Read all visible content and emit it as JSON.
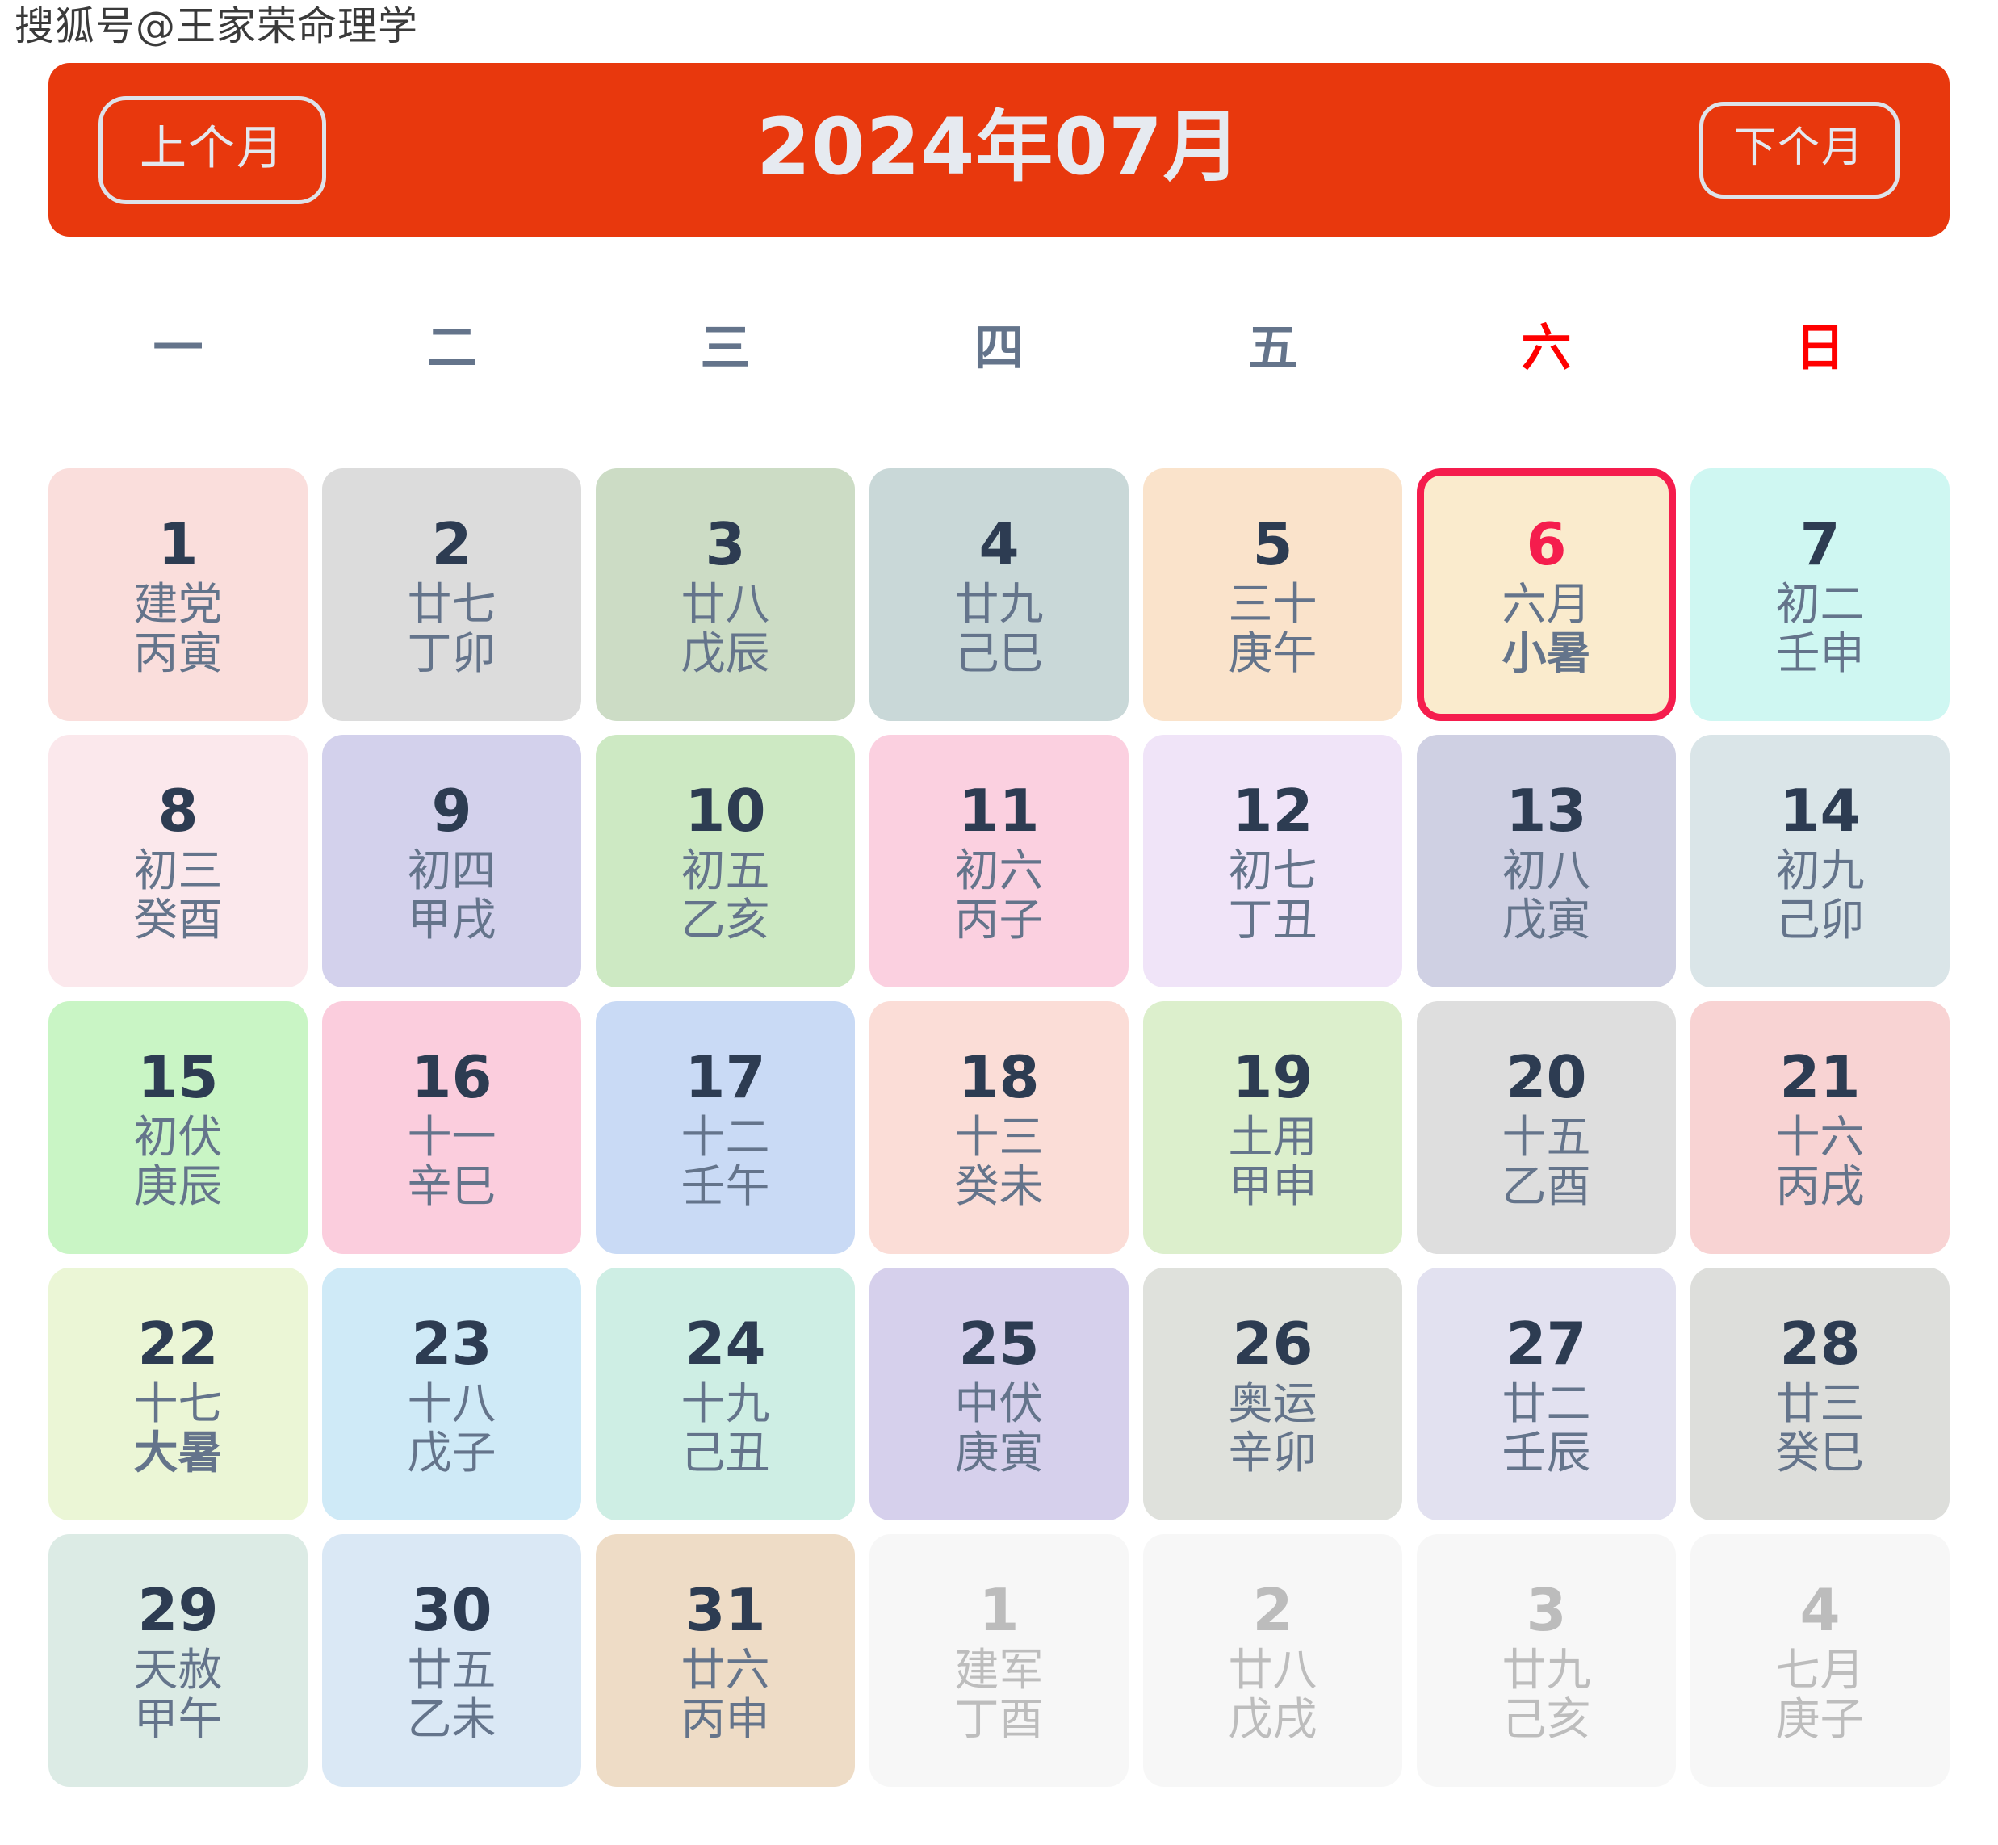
{
  "watermark": "搜狐号@王家荣命理学",
  "header": {
    "prev_label": "上个月",
    "title": "2024年07月",
    "next_label": "下个月",
    "bar_color": "#e8380d",
    "text_color": "#e6eaf0"
  },
  "weekdays": [
    {
      "label": "一",
      "weekend": false
    },
    {
      "label": "二",
      "weekend": false
    },
    {
      "label": "三",
      "weekend": false
    },
    {
      "label": "四",
      "weekend": false
    },
    {
      "label": "五",
      "weekend": false
    },
    {
      "label": "六",
      "weekend": true
    },
    {
      "label": "日",
      "weekend": true
    }
  ],
  "colors": {
    "weekday_normal": "#64748b",
    "weekend": "#ff0000",
    "daynum": "#2d3c52",
    "sublabel": "#64748b",
    "today_accent": "#f51d4d",
    "other_month_text": "#bdbdbd"
  },
  "cells": [
    {
      "day": "1",
      "l1": "建党",
      "l2": "丙寅",
      "bg": "#fadedc"
    },
    {
      "day": "2",
      "l1": "廿七",
      "l2": "丁卯",
      "bg": "#dcdcdc"
    },
    {
      "day": "3",
      "l1": "廿八",
      "l2": "戊辰",
      "bg": "#ccdcc5"
    },
    {
      "day": "4",
      "l1": "廿九",
      "l2": "己巳",
      "bg": "#c9d8d8"
    },
    {
      "day": "5",
      "l1": "三十",
      "l2": "庚午",
      "bg": "#fae3cb"
    },
    {
      "day": "6",
      "l1": "六月",
      "l2": "小暑",
      "bg": "#faebcd",
      "today": true
    },
    {
      "day": "7",
      "l1": "初二",
      "l2": "壬申",
      "bg": "#cff7f2"
    },
    {
      "day": "8",
      "l1": "初三",
      "l2": "癸酉",
      "bg": "#fbe8ec"
    },
    {
      "day": "9",
      "l1": "初四",
      "l2": "甲戌",
      "bg": "#d3d1ec"
    },
    {
      "day": "10",
      "l1": "初五",
      "l2": "乙亥",
      "bg": "#cde9c3"
    },
    {
      "day": "11",
      "l1": "初六",
      "l2": "丙子",
      "bg": "#fbd0e0"
    },
    {
      "day": "12",
      "l1": "初七",
      "l2": "丁丑",
      "bg": "#f0e4f8"
    },
    {
      "day": "13",
      "l1": "初八",
      "l2": "戊寅",
      "bg": "#cfd0e3"
    },
    {
      "day": "14",
      "l1": "初九",
      "l2": "己卯",
      "bg": "#dae5e8"
    },
    {
      "day": "15",
      "l1": "初伏",
      "l2": "庚辰",
      "bg": "#c9f5c5"
    },
    {
      "day": "16",
      "l1": "十一",
      "l2": "辛巳",
      "bg": "#fbcddd"
    },
    {
      "day": "17",
      "l1": "十二",
      "l2": "壬午",
      "bg": "#c9daf5"
    },
    {
      "day": "18",
      "l1": "十三",
      "l2": "癸未",
      "bg": "#fbddd7"
    },
    {
      "day": "19",
      "l1": "土用",
      "l2": "甲申",
      "bg": "#dcefcc"
    },
    {
      "day": "20",
      "l1": "十五",
      "l2": "乙酉",
      "bg": "#dedede"
    },
    {
      "day": "21",
      "l1": "十六",
      "l2": "丙戌",
      "bg": "#f8d3d3"
    },
    {
      "day": "22",
      "l1": "十七",
      "l2": "大暑",
      "bg": "#ebf6d6",
      "bold_l2": true
    },
    {
      "day": "23",
      "l1": "十八",
      "l2": "戊子",
      "bg": "#cfeaf7"
    },
    {
      "day": "24",
      "l1": "十九",
      "l2": "己丑",
      "bg": "#ceeee4"
    },
    {
      "day": "25",
      "l1": "中伏",
      "l2": "庚寅",
      "bg": "#d6d0ec"
    },
    {
      "day": "26",
      "l1": "奥运",
      "l2": "辛卯",
      "bg": "#dfe1dc"
    },
    {
      "day": "27",
      "l1": "廿二",
      "l2": "壬辰",
      "bg": "#e2e1f0"
    },
    {
      "day": "28",
      "l1": "廿三",
      "l2": "癸巳",
      "bg": "#dddedb"
    },
    {
      "day": "29",
      "l1": "天赦",
      "l2": "甲午",
      "bg": "#dcebe5"
    },
    {
      "day": "30",
      "l1": "廿五",
      "l2": "乙未",
      "bg": "#dae8f5"
    },
    {
      "day": "31",
      "l1": "廿六",
      "l2": "丙申",
      "bg": "#eedcc6"
    },
    {
      "day": "1",
      "l1": "建军",
      "l2": "丁酉",
      "bg": "#f7f7f7",
      "other": true
    },
    {
      "day": "2",
      "l1": "廿八",
      "l2": "戊戌",
      "bg": "#f7f7f7",
      "other": true
    },
    {
      "day": "3",
      "l1": "廿九",
      "l2": "己亥",
      "bg": "#f7f7f7",
      "other": true
    },
    {
      "day": "4",
      "l1": "七月",
      "l2": "庚子",
      "bg": "#f7f7f7",
      "other": true
    }
  ]
}
